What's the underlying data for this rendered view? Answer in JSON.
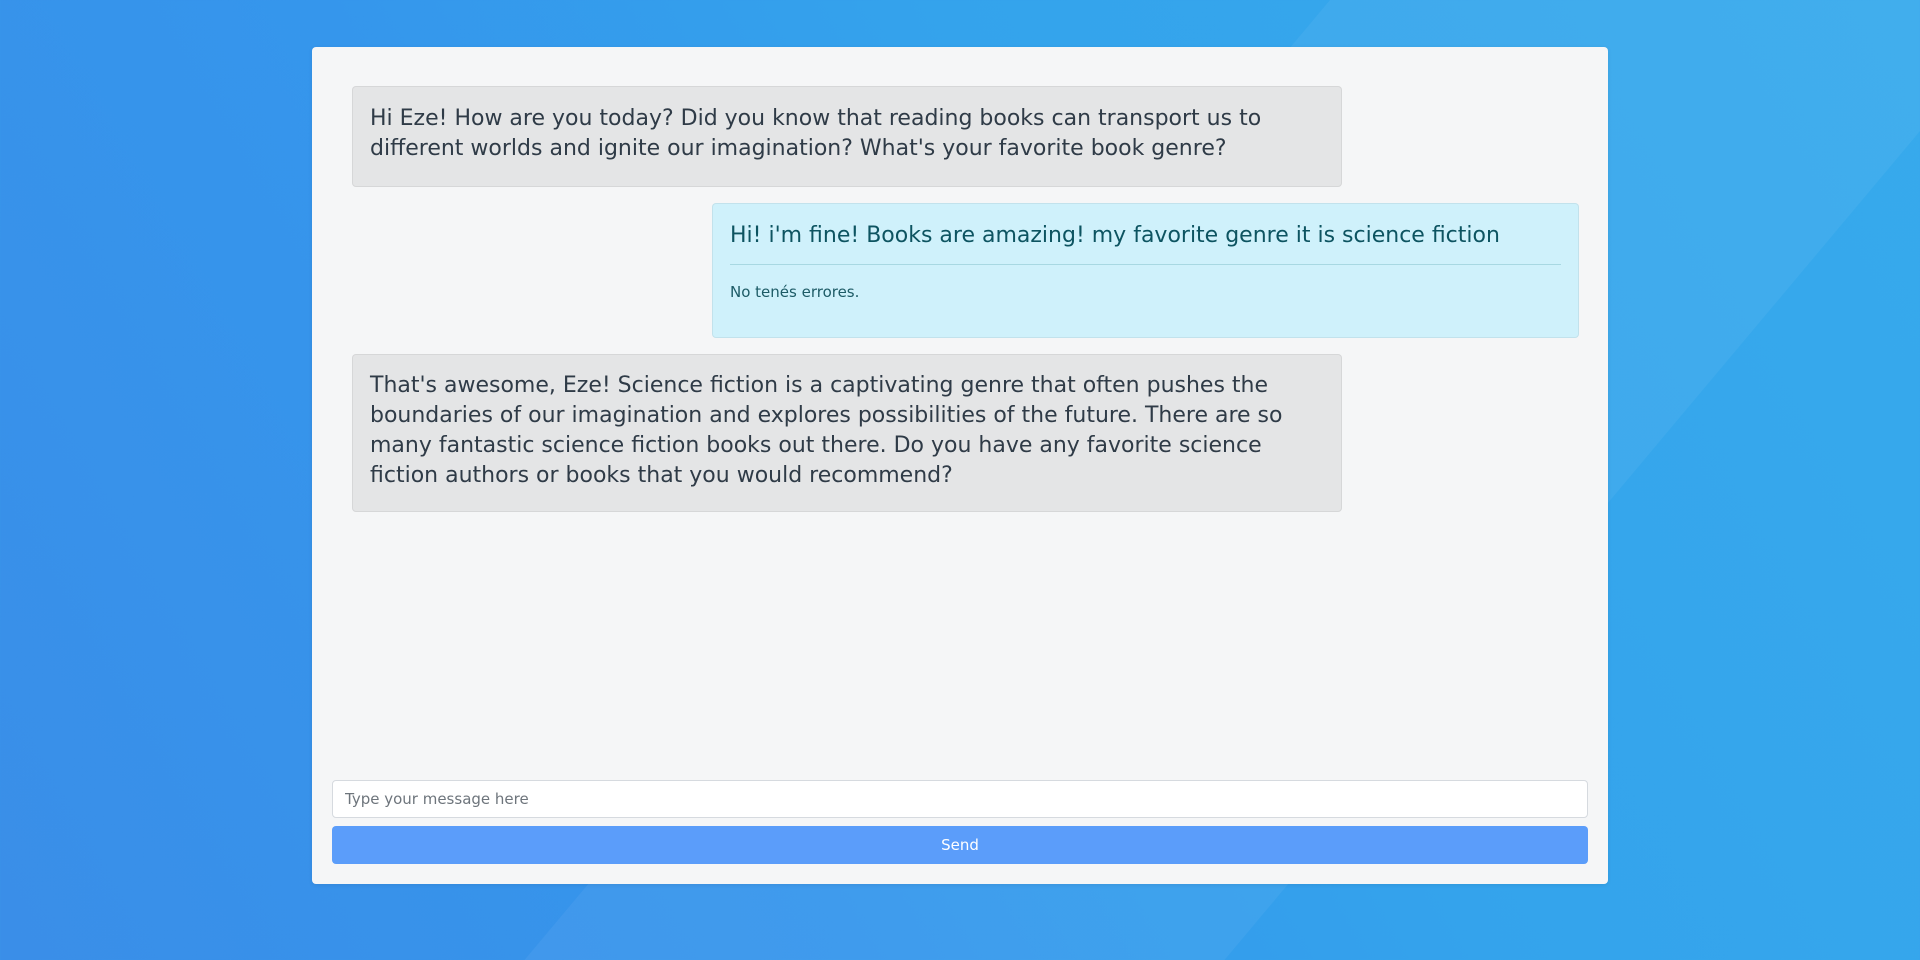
{
  "chat": {
    "messages": [
      {
        "role": "assistant",
        "text": "Hi Eze! How are you today? Did you know that reading books can transport us to different worlds and ignite our imagination? What's your favorite book genre?"
      },
      {
        "role": "user",
        "text": "Hi! i'm fine! Books are amazing! my favorite genre it is science fiction",
        "feedback": "No tenés errores."
      },
      {
        "role": "assistant",
        "text": "That's awesome, Eze! Science fiction is a captivating genre that often pushes the boundaries of our imagination and explores possibilities of the future. There are so many fantastic science fiction books out there. Do you have any favorite science fiction authors or books that you would recommend?"
      }
    ]
  },
  "composer": {
    "placeholder": "Type your message here",
    "value": "",
    "send_label": "Send"
  },
  "colors": {
    "assistant_bubble": "#e4e5e6",
    "user_bubble": "#cff1fb",
    "send_button": "#5b9dfa",
    "background": "#3596ec"
  }
}
